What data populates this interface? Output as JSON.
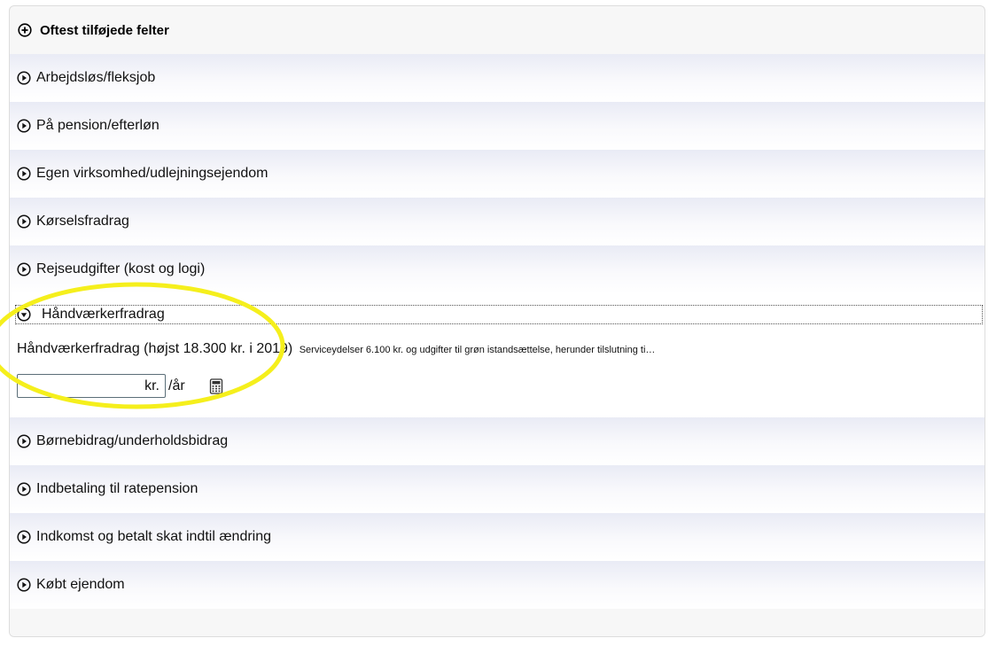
{
  "header": {
    "title": "Oftest tilføjede felter",
    "icon": "plus-circle-icon"
  },
  "sections": [
    {
      "label": "Arbejdsløs/fleksjob",
      "icon": "play-circle-icon"
    },
    {
      "label": "På pension/efterløn",
      "icon": "play-circle-icon"
    },
    {
      "label": "Egen virksomhed/udlejningsejendom",
      "icon": "play-circle-icon"
    },
    {
      "label": "Kørselsfradrag",
      "icon": "play-circle-icon"
    },
    {
      "label": "Rejseudgifter (kost og logi)",
      "icon": "play-circle-icon"
    }
  ],
  "expanded": {
    "label": "Håndværkerfradrag",
    "icon": "chevron-down-circle-icon",
    "field_label": "Håndværkerfradrag (højst 18.300 kr. i 2019)",
    "field_desc": "Serviceydelser 6.100 kr. og udgifter til grøn istandsættelse, herunder tilslutning ti…",
    "input_value": "",
    "unit": "kr.",
    "per": "/år",
    "calc_icon": "calculator-icon"
  },
  "sections_after": [
    {
      "label": "Børnebidrag/underholdsbidrag",
      "icon": "play-circle-icon"
    },
    {
      "label": "Indbetaling til ratepension",
      "icon": "play-circle-icon"
    },
    {
      "label": "Indkomst og betalt skat indtil ændring",
      "icon": "play-circle-icon"
    },
    {
      "label": "Købt ejendom",
      "icon": "play-circle-icon"
    }
  ],
  "colors": {
    "highlight": "#f5ef1c",
    "row_gradient_top": "#e9ebf5"
  }
}
